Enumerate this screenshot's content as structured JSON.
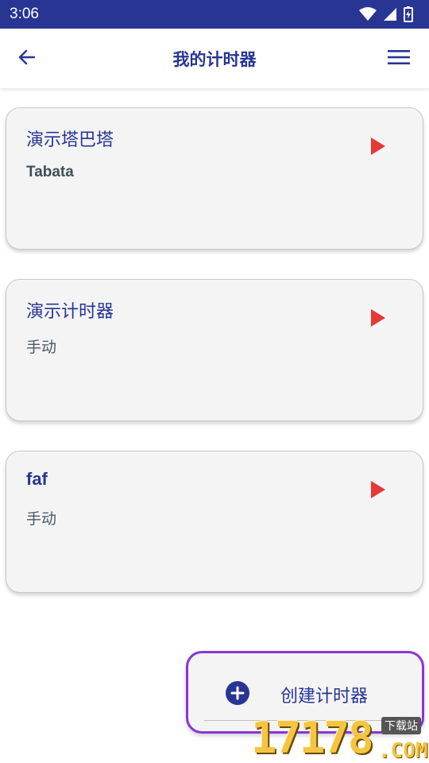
{
  "status_bar": {
    "time": "3:06"
  },
  "app_bar": {
    "title": "我的计时器"
  },
  "timers": [
    {
      "name": "演示塔巴塔",
      "type": "Tabata"
    },
    {
      "name": "演示计时器",
      "type": "手动"
    },
    {
      "name": "faf",
      "type": "手动"
    }
  ],
  "fab": {
    "label": "创建计时器"
  },
  "watermark": {
    "digits": "17178",
    "com": ".COM",
    "tag": "下载站"
  },
  "colors": {
    "primary": "#283593",
    "play": "#e53935",
    "card_bg": "#f4f4f5",
    "fab_border": "#8a35d6"
  },
  "icons": {
    "back": "arrow-left-icon",
    "menu": "hamburger-menu-icon",
    "play": "play-icon",
    "add": "plus-circle-icon",
    "wifi": "wifi-icon",
    "signal": "signal-icon",
    "battery": "battery-icon"
  }
}
